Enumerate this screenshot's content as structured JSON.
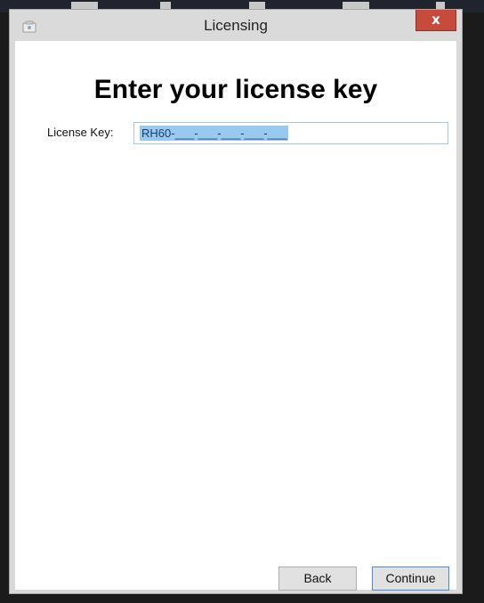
{
  "window": {
    "title": "Licensing",
    "close_glyph": "x"
  },
  "main": {
    "heading": "Enter your license key",
    "license_key_label": "License Key:",
    "license_key_value": "RH60-___-___-___-___-___"
  },
  "buttons": {
    "back": "Back",
    "continue": "Continue"
  },
  "colors": {
    "close_button": "#c74b3d",
    "selection_highlight": "#99c9ef",
    "focus_border": "#4a8cd2"
  },
  "icons": {
    "app": "licensing-app-icon",
    "close": "close-icon"
  }
}
